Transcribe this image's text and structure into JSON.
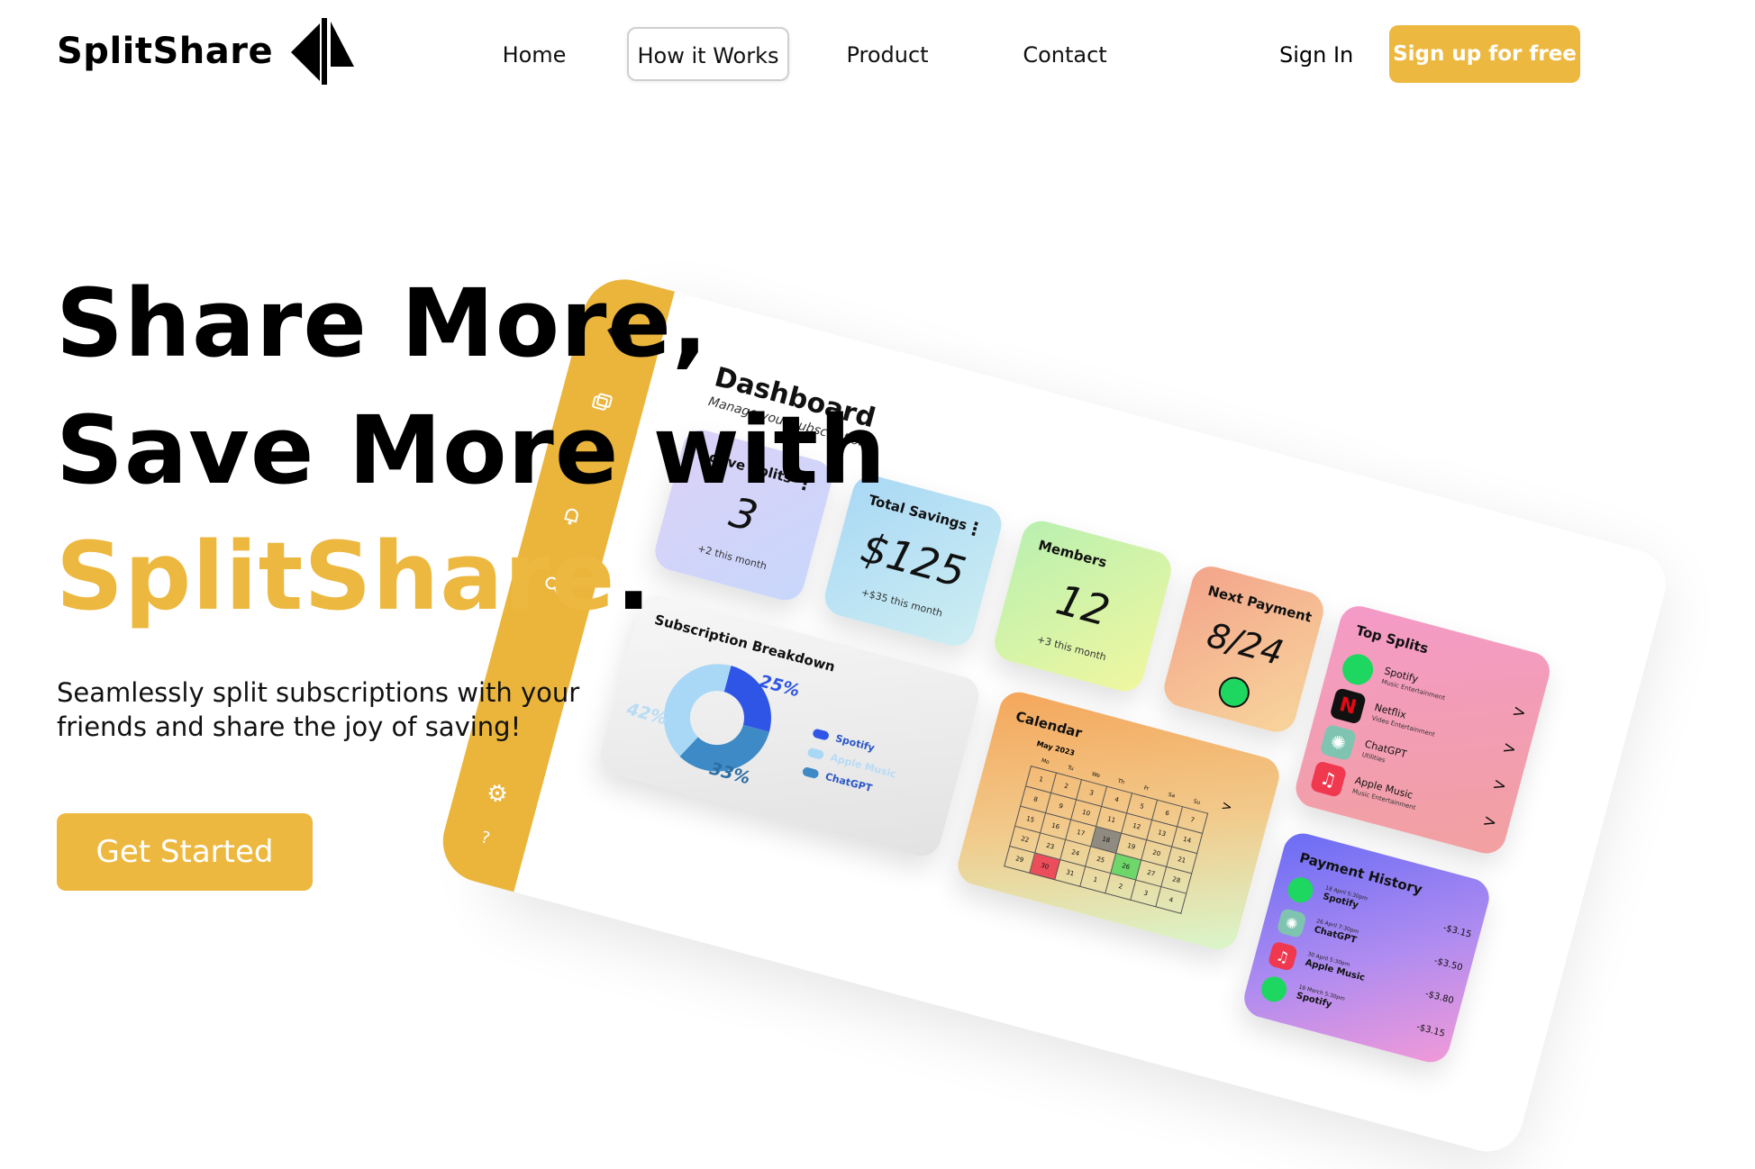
{
  "header": {
    "logo_text": "SplitShare",
    "nav": [
      {
        "label": "Home"
      },
      {
        "label": "How it Works",
        "active": true
      },
      {
        "label": "Product"
      },
      {
        "label": "Contact"
      }
    ],
    "sign_in": "Sign In",
    "sign_up": "Sign up for free"
  },
  "hero": {
    "line1": "Share More,",
    "line2": "Save More with",
    "line3_brand": "SplitShare",
    "line3_period": ".",
    "subtitle": "Seamlessly split subscriptions with your friends and share the joy of saving!",
    "cta": "Get Started"
  },
  "colors": {
    "brand": "#edb83f"
  },
  "dashboard": {
    "title": "Dashboard",
    "subtitle": "Manage your subscriptions",
    "sidebar_icons": [
      "logo-icon",
      "cards-icon",
      "bell-icon",
      "search-icon",
      "gear-icon",
      "help-icon"
    ],
    "stats": [
      {
        "title": "Active Splits",
        "value": "3",
        "note": "+2 this month"
      },
      {
        "title": "Total Savings",
        "value": "$125",
        "note": "+$35 this month"
      },
      {
        "title": "Members",
        "value": "12",
        "note": "+3 this month"
      },
      {
        "title": "Next Payment",
        "value": "8/24",
        "icon": "spotify-icon"
      }
    ],
    "top_splits": {
      "title": "Top Splits",
      "items": [
        {
          "name": "Spotify",
          "category": "Music Entertainment",
          "icon": "spotify-icon"
        },
        {
          "name": "Netflix",
          "category": "Video Entertainment",
          "icon": "netflix-icon"
        },
        {
          "name": "ChatGPT",
          "category": "Utilities",
          "icon": "chatgpt-icon"
        },
        {
          "name": "Apple Music",
          "category": "Music Entertainment",
          "icon": "apple-music-icon"
        }
      ]
    },
    "breakdown": {
      "title": "Subscription Breakdown",
      "slices": [
        {
          "label": "25%",
          "value": 25
        },
        {
          "label": "33%",
          "value": 33
        },
        {
          "label": "42%",
          "value": 42
        }
      ],
      "legend": [
        "Spotify",
        "Apple Music",
        "ChatGPT"
      ]
    },
    "calendar": {
      "title": "Calendar",
      "month": "May 2023",
      "days_header": [
        "Mo",
        "Tu",
        "We",
        "Th",
        "Fr",
        "Sa",
        "Su"
      ],
      "rows": [
        [
          "1",
          "2",
          "3",
          "4",
          "5",
          "6",
          "7"
        ],
        [
          "8",
          "9",
          "10",
          "11",
          "12",
          "13",
          "14"
        ],
        [
          "15",
          "16",
          "17",
          "18",
          "19",
          "20",
          "21"
        ],
        [
          "22",
          "23",
          "24",
          "25",
          "26",
          "27",
          "28"
        ],
        [
          "29",
          "30",
          "31",
          "1",
          "2",
          "3",
          "4"
        ]
      ],
      "highlight_gray": "18",
      "highlight_green": "26",
      "highlight_red": "30",
      "next_arrow": ">"
    },
    "payment_history": {
      "title": "Payment History",
      "items": [
        {
          "date": "18 April 5:30pm",
          "name": "Spotify",
          "amount": "-$3.15",
          "icon": "spotify-icon"
        },
        {
          "date": "26 April 7:30pm",
          "name": "ChatGPT",
          "amount": "-$3.50",
          "icon": "chatgpt-icon"
        },
        {
          "date": "30 April 5:30pm",
          "name": "Apple Music",
          "amount": "-$3.80",
          "icon": "apple-music-icon"
        },
        {
          "date": "18 March 5:30pm",
          "name": "Spotify",
          "amount": "-$3.15",
          "icon": "spotify-icon"
        }
      ]
    }
  }
}
